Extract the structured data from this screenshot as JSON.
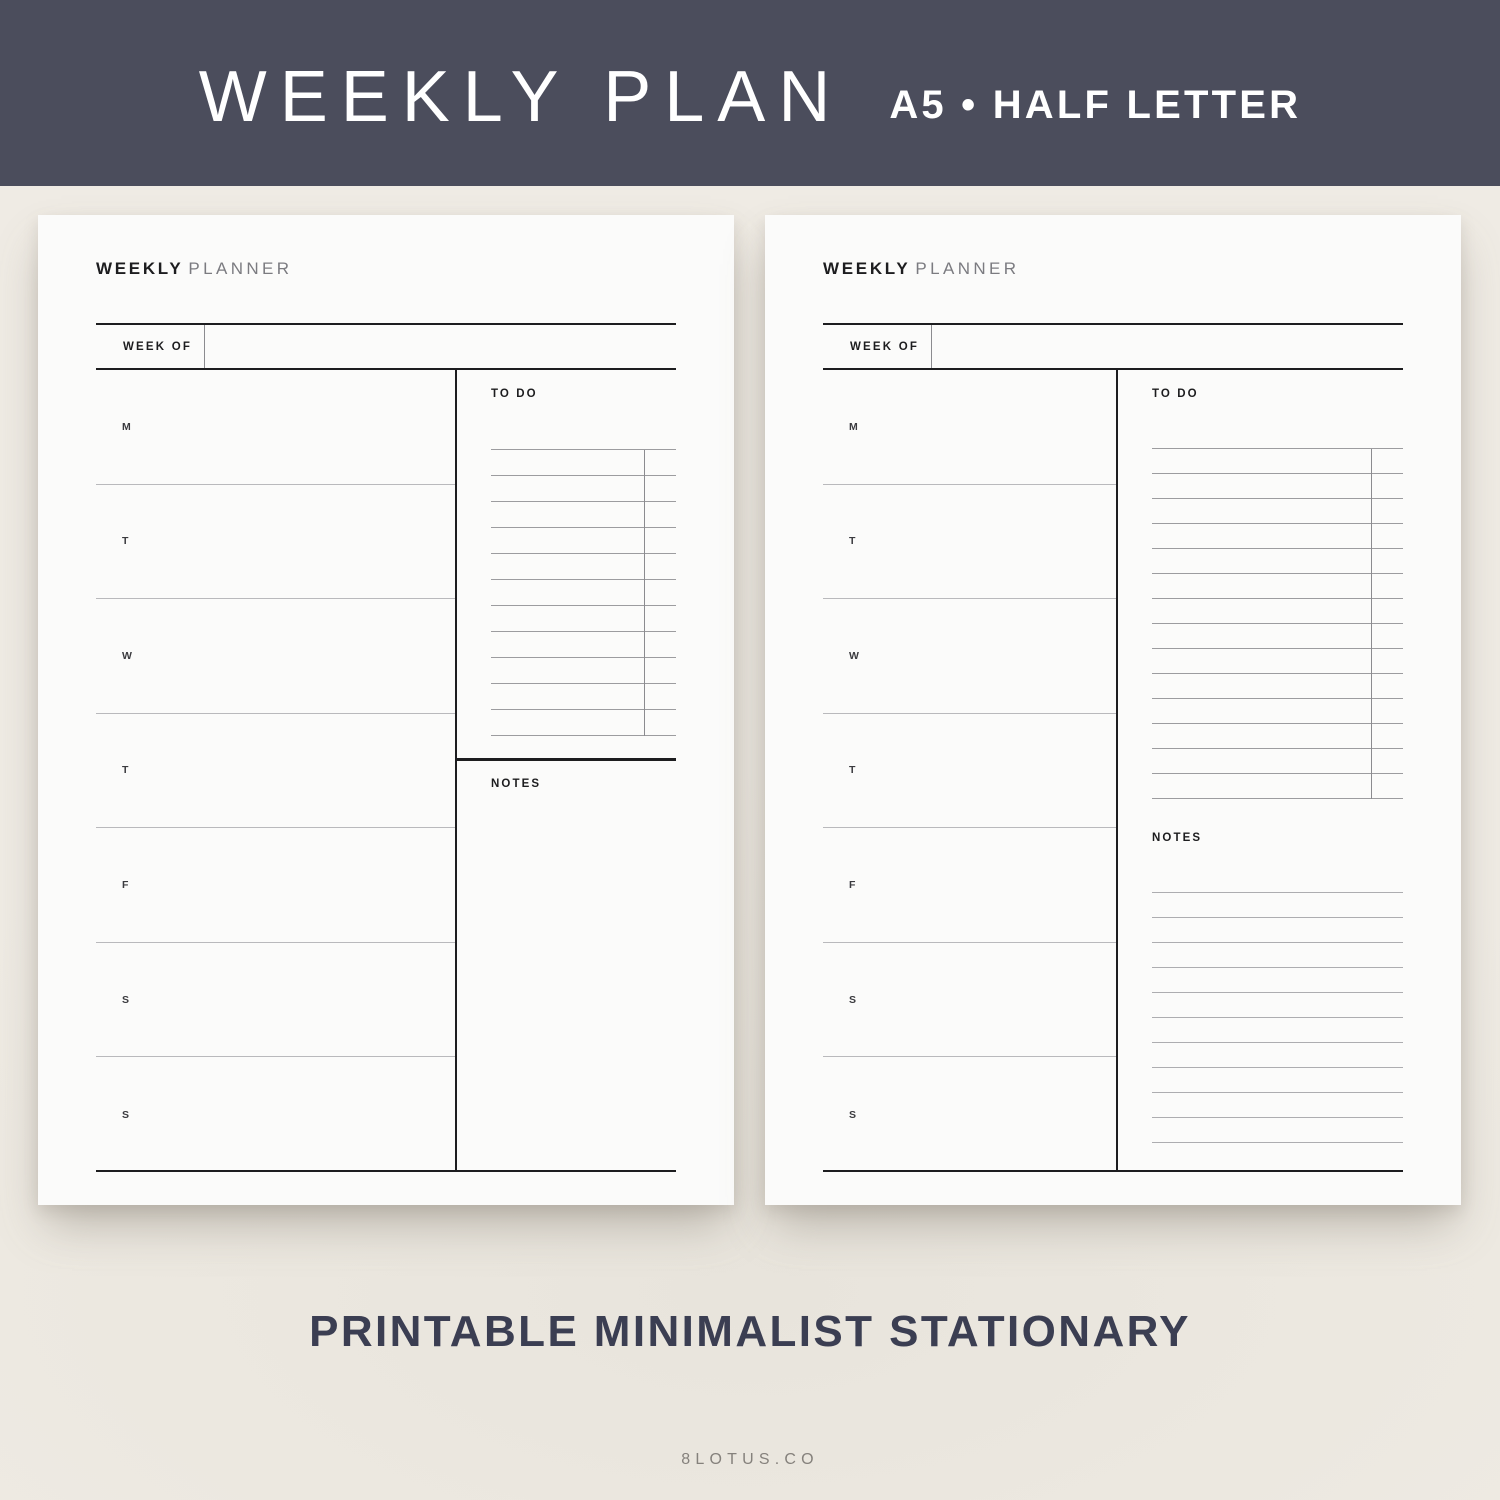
{
  "banner": {
    "title": "WEEKLY PLAN",
    "subtitle": "A5 • HALF LETTER",
    "background_color": "#4b4d5c",
    "text_color": "#ffffff"
  },
  "canvas": {
    "background_color": "#ece8e0",
    "page_color": "#fbfbfa"
  },
  "pages": [
    {
      "id": "left",
      "heading": {
        "bold": "WEEKLY",
        "light": "PLANNER"
      },
      "week_of": {
        "label": "WEEK OF",
        "value": ""
      },
      "days": [
        "M",
        "T",
        "W",
        "T",
        "F",
        "S",
        "S"
      ],
      "todo": {
        "title": "TO DO",
        "line_count": 12,
        "has_check_column": true
      },
      "notes": {
        "title": "NOTES",
        "line_count": 0
      }
    },
    {
      "id": "right",
      "heading": {
        "bold": "WEEKLY",
        "light": "PLANNER"
      },
      "week_of": {
        "label": "WEEK OF",
        "value": ""
      },
      "days": [
        "M",
        "T",
        "W",
        "T",
        "F",
        "S",
        "S"
      ],
      "todo": {
        "title": "TO DO",
        "line_count": 15,
        "has_check_column": true
      },
      "notes": {
        "title": "NOTES",
        "line_count": 11
      }
    }
  ],
  "caption": "PRINTABLE MINIMALIST STATIONARY",
  "brand": "8LOTUS.CO"
}
